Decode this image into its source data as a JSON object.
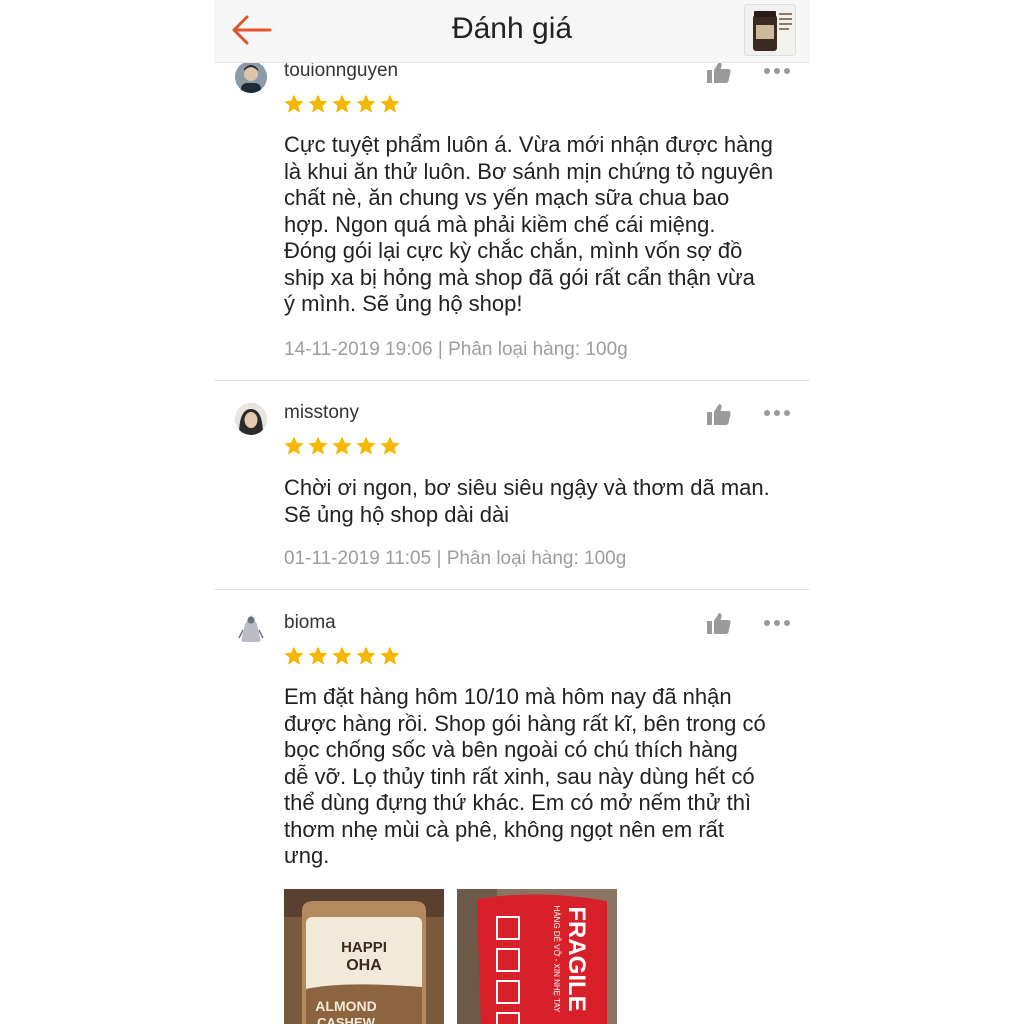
{
  "header": {
    "title": "Đánh giá",
    "back_icon": "arrow-left-icon",
    "accent": "#e2542b",
    "product_thumb": "ALMOND CASHEW BUTTER"
  },
  "reviews": [
    {
      "username": "touionnguyen",
      "rating": 5,
      "text": "Cực tuyệt phẩm luôn á. Vừa mới nhận được hàng\nlà khui ăn thử luôn. Bơ sánh mịn chứng tỏ nguyên\nchất nè, ăn chung vs yến mạch sữa chua bao\nhợp. Ngon quá mà phải kiềm chế cái miệng.\nĐóng gói lại cực kỳ chắc chắn, mình vốn sợ đồ\nship xa bị hỏng mà shop đã gói rất cẩn thận vừa\ný mình. Sẽ ủng hộ shop!",
      "meta": "14-11-2019 19:06 | Phân loại hàng: 100g"
    },
    {
      "username": "misstony",
      "rating": 5,
      "text": "Chời ơi ngon, bơ siêu siêu ngậy và thơm dã man.\nSẽ ủng hộ shop dài dài",
      "meta": "01-11-2019 11:05 | Phân loại hàng: 100g"
    },
    {
      "username": "bioma",
      "rating": 5,
      "text": "Em đặt hàng hôm 10/10 mà hôm nay đã nhận\nđược hàng rồi. Shop gói hàng rất kĩ, bên trong có\nbọc chống sốc và bên ngoài có chú thích hàng\ndễ vỡ. Lọ thủy tinh rất xinh, sau này dùng hết có\nthể dùng đựng thứ khác. Em có mở nếm thử  thì\nthơm nhẹ mùi cà phê, không ngọt nên em rất\nưng.",
      "photos": [
        {
          "brand": "HAPPI",
          "brand2": "OHA",
          "product1": "ALMOND",
          "product2": "CASHEW"
        },
        {
          "label": "FRAGILE",
          "sublabel": "HÀNG DỄ VỠ - XIN NHẸ TAY"
        }
      ]
    }
  ],
  "colors": {
    "star": "#f5b800",
    "icon_gray": "#9a9a9a",
    "meta_gray": "#9d9d9d"
  }
}
